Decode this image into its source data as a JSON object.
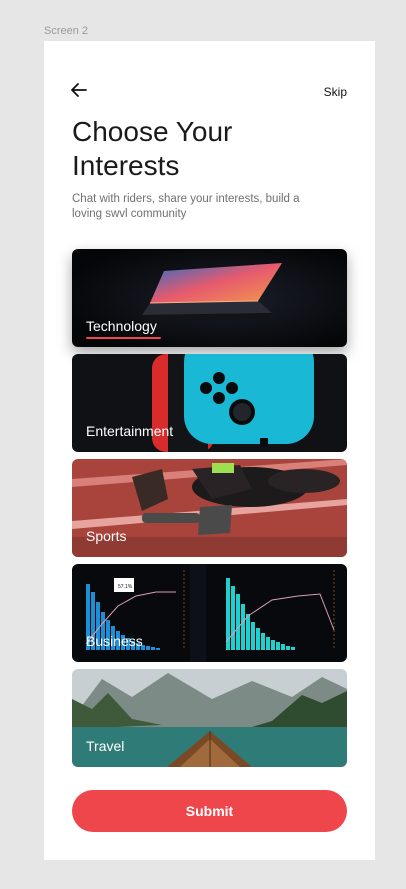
{
  "canvas_label": "Screen 2",
  "header": {
    "skip_label": "Skip"
  },
  "page": {
    "title": "Choose Your\nInterests",
    "subtitle": "Chat with riders, share your interests, build a loving swvl community"
  },
  "interests": [
    {
      "label": "Technology",
      "selected": true
    },
    {
      "label": "Entertainment",
      "selected": false
    },
    {
      "label": "Sports",
      "selected": false
    },
    {
      "label": "Business",
      "selected": false
    },
    {
      "label": "Travel",
      "selected": false
    }
  ],
  "business_chart": {
    "tooltip": "57.1%"
  },
  "submit_label": "Submit",
  "colors": {
    "accent": "#ef464b",
    "background": "#e6e6e6"
  }
}
